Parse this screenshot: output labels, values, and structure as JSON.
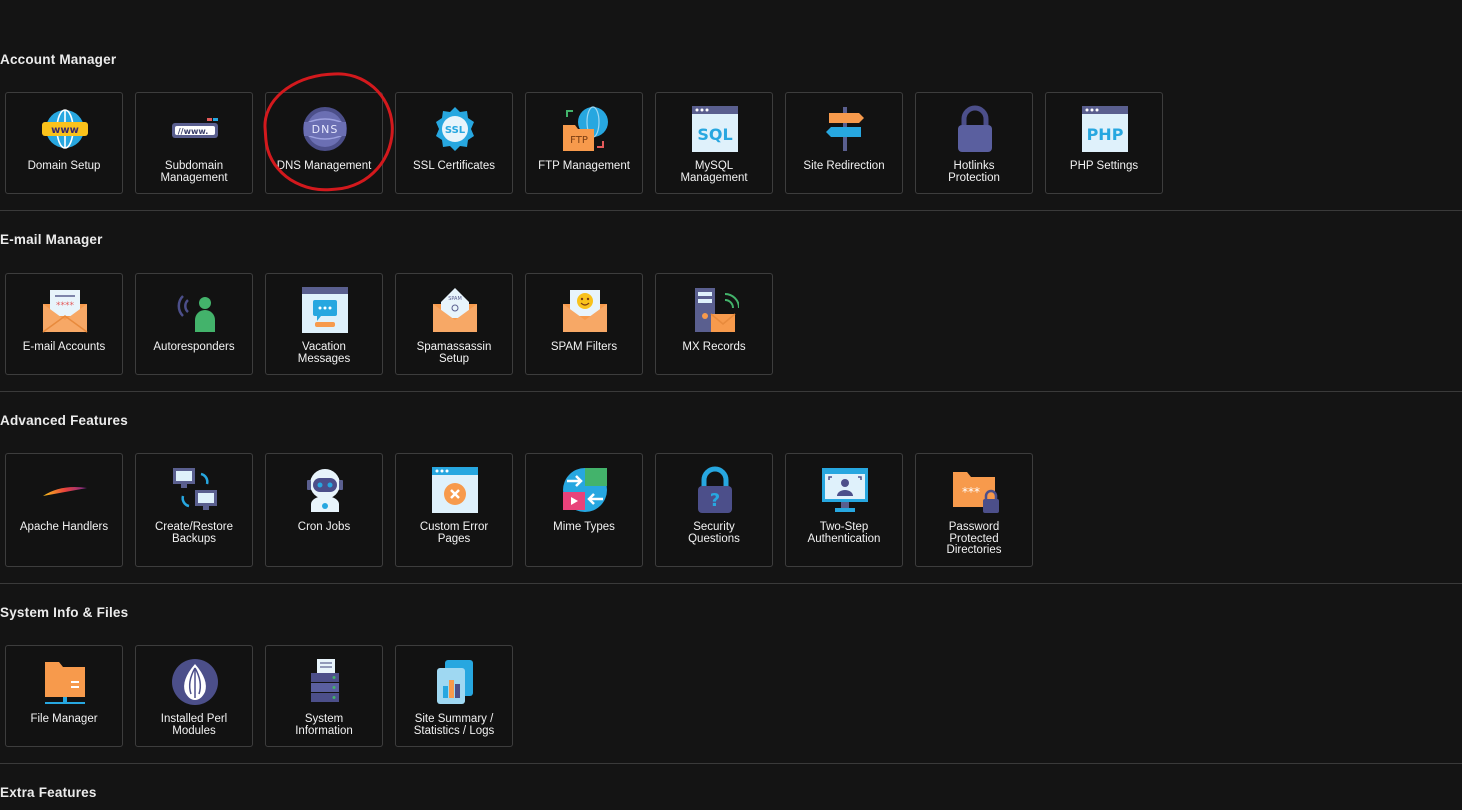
{
  "sections": {
    "account": {
      "title": "Account Manager",
      "items": [
        {
          "label": "Domain Setup",
          "icon": "globe-www-icon"
        },
        {
          "label": "Subdomain\nManagement",
          "icon": "subdomain-icon"
        },
        {
          "label": "DNS Management",
          "icon": "dns-globe-icon"
        },
        {
          "label": "SSL Certificates",
          "icon": "ssl-badge-icon"
        },
        {
          "label": "FTP Management",
          "icon": "ftp-folder-icon"
        },
        {
          "label": "MySQL\nManagement",
          "icon": "sql-window-icon"
        },
        {
          "label": "Site Redirection",
          "icon": "signpost-icon"
        },
        {
          "label": "Hotlinks\nProtection",
          "icon": "padlock-icon"
        },
        {
          "label": "PHP Settings",
          "icon": "php-window-icon"
        }
      ]
    },
    "email": {
      "title": "E-mail Manager",
      "items": [
        {
          "label": "E-mail Accounts",
          "icon": "envelope-password-icon"
        },
        {
          "label": "Autoresponders",
          "icon": "person-broadcast-icon"
        },
        {
          "label": "Vacation\nMessages",
          "icon": "message-window-icon"
        },
        {
          "label": "Spamassassin\nSetup",
          "icon": "spam-envelope-icon"
        },
        {
          "label": "SPAM Filters",
          "icon": "smiley-envelope-icon"
        },
        {
          "label": "MX Records",
          "icon": "mail-server-icon"
        }
      ]
    },
    "advanced": {
      "title": "Advanced Features",
      "items": [
        {
          "label": "Apache Handlers",
          "icon": "apache-feather-icon"
        },
        {
          "label": "Create/Restore\nBackups",
          "icon": "backup-monitors-icon"
        },
        {
          "label": "Cron Jobs",
          "icon": "robot-icon"
        },
        {
          "label": "Custom Error\nPages",
          "icon": "error-window-icon"
        },
        {
          "label": "Mime Types",
          "icon": "mime-globe-icon"
        },
        {
          "label": "Security\nQuestions",
          "icon": "question-lock-icon"
        },
        {
          "label": "Two-Step\nAuthentication",
          "icon": "face-scan-monitor-icon"
        },
        {
          "label": "Password\nProtected\nDirectories",
          "icon": "password-folder-icon"
        }
      ]
    },
    "system": {
      "title": "System Info & Files",
      "items": [
        {
          "label": "File Manager",
          "icon": "network-folder-icon"
        },
        {
          "label": "Installed Perl\nModules",
          "icon": "perl-onion-icon"
        },
        {
          "label": "System\nInformation",
          "icon": "server-document-icon"
        },
        {
          "label": "Site Summary /\nStatistics / Logs",
          "icon": "stats-document-icon"
        }
      ]
    },
    "extra": {
      "title": "Extra Features"
    }
  },
  "annotation": {
    "highlighted_item": "DNS Management",
    "color": "#d3191d"
  },
  "colors": {
    "background": "#141414",
    "tile_border": "#3d3d3d",
    "divider": "#3a3a3a",
    "text": "#ececec"
  }
}
